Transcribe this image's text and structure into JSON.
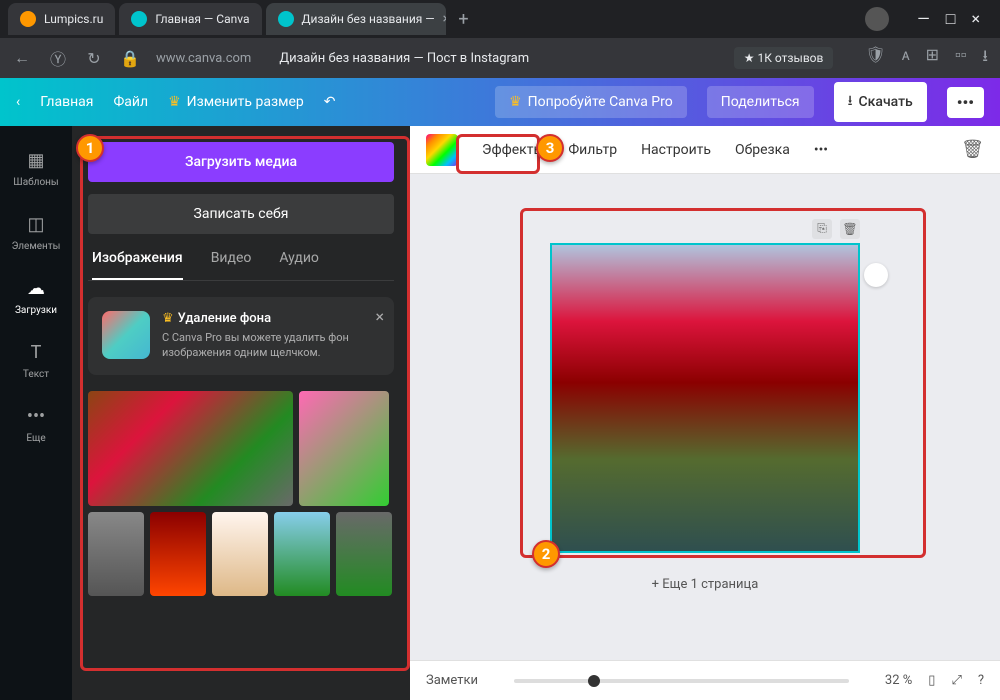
{
  "chrome": {
    "tabs": [
      {
        "label": "Lumpics.ru"
      },
      {
        "label": "Главная — Canva"
      },
      {
        "label": "Дизайн без названия —"
      }
    ],
    "url": "www.canva.com",
    "page_title": "Дизайн без названия — Пост в Instagram",
    "reviews": "★ 1К отзывов"
  },
  "header": {
    "back": "‹",
    "home": "Главная",
    "file": "Файл",
    "resize": "Изменить размер",
    "try_pro": "Попробуйте Canva Pro",
    "share": "Поделиться",
    "download": "Скачать",
    "more": "•••"
  },
  "rail": {
    "templates": "Шаблоны",
    "elements": "Элементы",
    "uploads": "Загрузки",
    "text": "Текст",
    "more": "Еще"
  },
  "panel": {
    "upload": "Загрузить медиа",
    "record": "Записать себя",
    "tab_images": "Изображения",
    "tab_video": "Видео",
    "tab_audio": "Аудио",
    "promo_title": "Удаление фона",
    "promo_desc": "С Canva Pro вы можете удалить фон изображения одним щелчком."
  },
  "toolbar": {
    "effects": "Эффекты",
    "filter": "Фильтр",
    "adjust": "Настроить",
    "crop": "Обрезка",
    "more": "•••"
  },
  "canvas": {
    "add_page": "+ Еще 1 страница"
  },
  "bottom": {
    "notes": "Заметки",
    "zoom": "32 %"
  },
  "markers": {
    "m1": "1",
    "m2": "2",
    "m3": "3"
  }
}
